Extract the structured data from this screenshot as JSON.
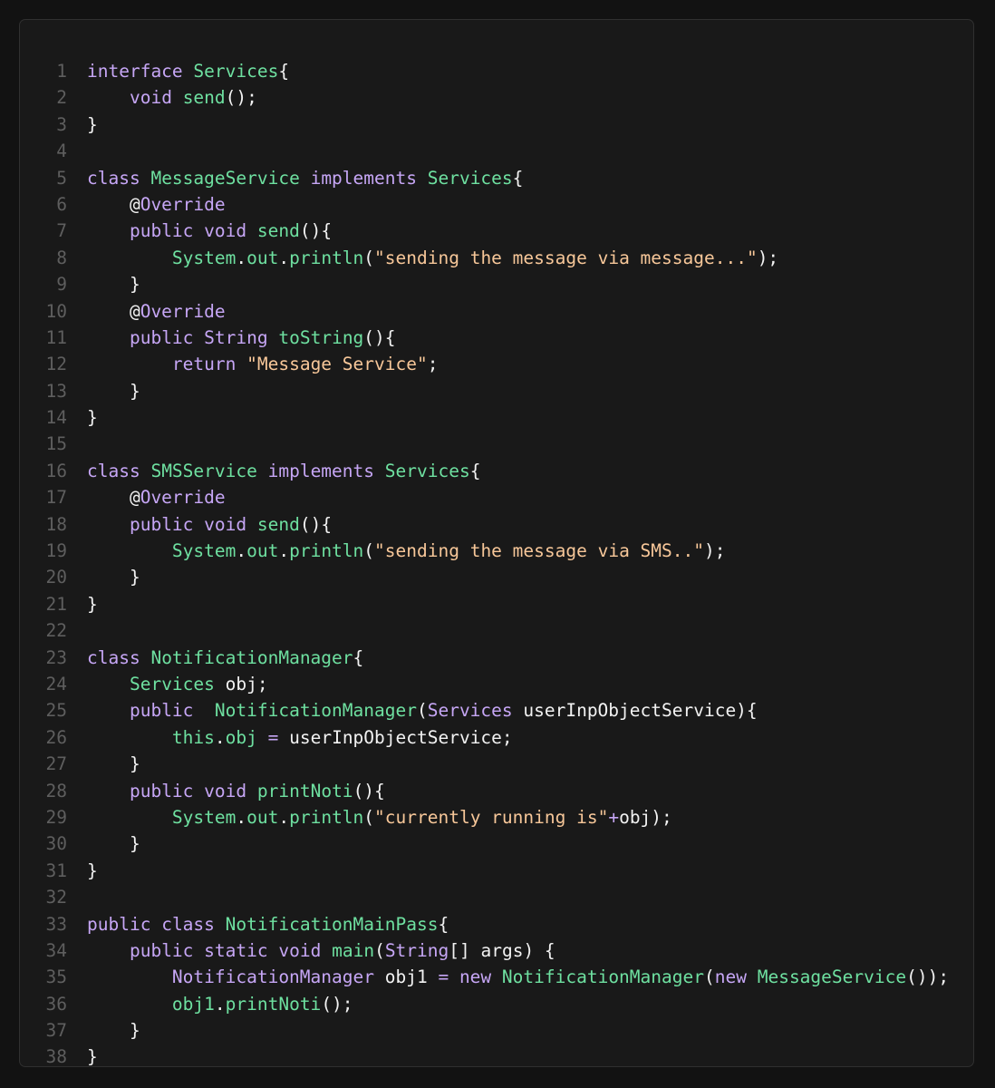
{
  "colors": {
    "background": "#121212",
    "panel": "#191919",
    "border": "#303030",
    "line_number": "#5e5e5e",
    "plain": "#f2f2f2",
    "keyword": "#c6a6f5",
    "type": "#6ee0a0",
    "string": "#f7c799"
  },
  "lines": [
    {
      "n": "1",
      "tokens": [
        [
          "kw",
          "interface"
        ],
        [
          "plain",
          " "
        ],
        [
          "type",
          "Services"
        ],
        [
          "plain",
          "{"
        ]
      ]
    },
    {
      "n": "2",
      "tokens": [
        [
          "plain",
          "    "
        ],
        [
          "kw",
          "void"
        ],
        [
          "plain",
          " "
        ],
        [
          "fn",
          "send"
        ],
        [
          "plain",
          "();"
        ]
      ]
    },
    {
      "n": "3",
      "tokens": [
        [
          "plain",
          "}"
        ]
      ]
    },
    {
      "n": "4",
      "tokens": []
    },
    {
      "n": "5",
      "tokens": [
        [
          "kw",
          "class"
        ],
        [
          "plain",
          " "
        ],
        [
          "type",
          "MessageService"
        ],
        [
          "plain",
          " "
        ],
        [
          "kw",
          "implements"
        ],
        [
          "plain",
          " "
        ],
        [
          "type",
          "Services"
        ],
        [
          "plain",
          "{"
        ]
      ]
    },
    {
      "n": "6",
      "tokens": [
        [
          "plain",
          "    @"
        ],
        [
          "ann",
          "Override"
        ]
      ]
    },
    {
      "n": "7",
      "tokens": [
        [
          "plain",
          "    "
        ],
        [
          "kw",
          "public"
        ],
        [
          "plain",
          " "
        ],
        [
          "kw",
          "void"
        ],
        [
          "plain",
          " "
        ],
        [
          "fn",
          "send"
        ],
        [
          "plain",
          "(){"
        ]
      ]
    },
    {
      "n": "8",
      "tokens": [
        [
          "plain",
          "        "
        ],
        [
          "type",
          "System"
        ],
        [
          "plain",
          "."
        ],
        [
          "fn",
          "out"
        ],
        [
          "plain",
          "."
        ],
        [
          "fn",
          "println"
        ],
        [
          "plain",
          "("
        ],
        [
          "str",
          "\"sending the message via message...\""
        ],
        [
          "plain",
          ");"
        ]
      ]
    },
    {
      "n": "9",
      "tokens": [
        [
          "plain",
          "    }"
        ]
      ]
    },
    {
      "n": "10",
      "tokens": [
        [
          "plain",
          "    @"
        ],
        [
          "ann",
          "Override"
        ]
      ]
    },
    {
      "n": "11",
      "tokens": [
        [
          "plain",
          "    "
        ],
        [
          "kw",
          "public"
        ],
        [
          "plain",
          " "
        ],
        [
          "kw",
          "String"
        ],
        [
          "plain",
          " "
        ],
        [
          "fn",
          "toString"
        ],
        [
          "plain",
          "(){"
        ]
      ]
    },
    {
      "n": "12",
      "tokens": [
        [
          "plain",
          "        "
        ],
        [
          "kw",
          "return"
        ],
        [
          "plain",
          " "
        ],
        [
          "str",
          "\"Message Service\""
        ],
        [
          "plain",
          ";"
        ]
      ]
    },
    {
      "n": "13",
      "tokens": [
        [
          "plain",
          "    }"
        ]
      ]
    },
    {
      "n": "14",
      "tokens": [
        [
          "plain",
          "}"
        ]
      ]
    },
    {
      "n": "15",
      "tokens": []
    },
    {
      "n": "16",
      "tokens": [
        [
          "kw",
          "class"
        ],
        [
          "plain",
          " "
        ],
        [
          "type",
          "SMSService"
        ],
        [
          "plain",
          " "
        ],
        [
          "kw",
          "implements"
        ],
        [
          "plain",
          " "
        ],
        [
          "type",
          "Services"
        ],
        [
          "plain",
          "{"
        ]
      ]
    },
    {
      "n": "17",
      "tokens": [
        [
          "plain",
          "    @"
        ],
        [
          "ann",
          "Override"
        ]
      ]
    },
    {
      "n": "18",
      "tokens": [
        [
          "plain",
          "    "
        ],
        [
          "kw",
          "public"
        ],
        [
          "plain",
          " "
        ],
        [
          "kw",
          "void"
        ],
        [
          "plain",
          " "
        ],
        [
          "fn",
          "send"
        ],
        [
          "plain",
          "(){"
        ]
      ]
    },
    {
      "n": "19",
      "tokens": [
        [
          "plain",
          "        "
        ],
        [
          "type",
          "System"
        ],
        [
          "plain",
          "."
        ],
        [
          "fn",
          "out"
        ],
        [
          "plain",
          "."
        ],
        [
          "fn",
          "println"
        ],
        [
          "plain",
          "("
        ],
        [
          "str",
          "\"sending the message via SMS..\""
        ],
        [
          "plain",
          ");"
        ]
      ]
    },
    {
      "n": "20",
      "tokens": [
        [
          "plain",
          "    }"
        ]
      ]
    },
    {
      "n": "21",
      "tokens": [
        [
          "plain",
          "}"
        ]
      ]
    },
    {
      "n": "22",
      "tokens": []
    },
    {
      "n": "23",
      "tokens": [
        [
          "kw",
          "class"
        ],
        [
          "plain",
          " "
        ],
        [
          "type",
          "NotificationManager"
        ],
        [
          "plain",
          "{"
        ]
      ]
    },
    {
      "n": "24",
      "tokens": [
        [
          "plain",
          "    "
        ],
        [
          "type",
          "Services"
        ],
        [
          "plain",
          " obj;"
        ]
      ]
    },
    {
      "n": "25",
      "tokens": [
        [
          "plain",
          "    "
        ],
        [
          "kw",
          "public"
        ],
        [
          "plain",
          "  "
        ],
        [
          "fn",
          "NotificationManager"
        ],
        [
          "plain",
          "("
        ],
        [
          "kw",
          "Services"
        ],
        [
          "plain",
          " userInpObjectService){"
        ]
      ]
    },
    {
      "n": "26",
      "tokens": [
        [
          "plain",
          "        "
        ],
        [
          "type",
          "this"
        ],
        [
          "plain",
          "."
        ],
        [
          "fn",
          "obj"
        ],
        [
          "plain",
          " "
        ],
        [
          "op",
          "="
        ],
        [
          "plain",
          " userInpObjectService;"
        ]
      ]
    },
    {
      "n": "27",
      "tokens": [
        [
          "plain",
          "    }"
        ]
      ]
    },
    {
      "n": "28",
      "tokens": [
        [
          "plain",
          "    "
        ],
        [
          "kw",
          "public"
        ],
        [
          "plain",
          " "
        ],
        [
          "kw",
          "void"
        ],
        [
          "plain",
          " "
        ],
        [
          "fn",
          "printNoti"
        ],
        [
          "plain",
          "(){"
        ]
      ]
    },
    {
      "n": "29",
      "tokens": [
        [
          "plain",
          "        "
        ],
        [
          "type",
          "System"
        ],
        [
          "plain",
          "."
        ],
        [
          "fn",
          "out"
        ],
        [
          "plain",
          "."
        ],
        [
          "fn",
          "println"
        ],
        [
          "plain",
          "("
        ],
        [
          "str",
          "\"currently running is\""
        ],
        [
          "op",
          "+"
        ],
        [
          "plain",
          "obj);"
        ]
      ]
    },
    {
      "n": "30",
      "tokens": [
        [
          "plain",
          "    }"
        ]
      ]
    },
    {
      "n": "31",
      "tokens": [
        [
          "plain",
          "}"
        ]
      ]
    },
    {
      "n": "32",
      "tokens": []
    },
    {
      "n": "33",
      "tokens": [
        [
          "kw",
          "public"
        ],
        [
          "plain",
          " "
        ],
        [
          "kw",
          "class"
        ],
        [
          "plain",
          " "
        ],
        [
          "type",
          "NotificationMainPass"
        ],
        [
          "plain",
          "{"
        ]
      ]
    },
    {
      "n": "34",
      "tokens": [
        [
          "plain",
          "    "
        ],
        [
          "kw",
          "public"
        ],
        [
          "plain",
          " "
        ],
        [
          "kw",
          "static"
        ],
        [
          "plain",
          " "
        ],
        [
          "kw",
          "void"
        ],
        [
          "plain",
          " "
        ],
        [
          "fn",
          "main"
        ],
        [
          "plain",
          "("
        ],
        [
          "kw",
          "String"
        ],
        [
          "plain",
          "[] args) {"
        ]
      ]
    },
    {
      "n": "35",
      "tokens": [
        [
          "plain",
          "        "
        ],
        [
          "kw",
          "NotificationManager"
        ],
        [
          "plain",
          " obj1 "
        ],
        [
          "op",
          "="
        ],
        [
          "plain",
          " "
        ],
        [
          "kw",
          "new"
        ],
        [
          "plain",
          " "
        ],
        [
          "fn",
          "NotificationManager"
        ],
        [
          "plain",
          "("
        ],
        [
          "kw",
          "new"
        ],
        [
          "plain",
          " "
        ],
        [
          "type",
          "MessageService"
        ],
        [
          "plain",
          "());"
        ]
      ]
    },
    {
      "n": "36",
      "tokens": [
        [
          "plain",
          "        "
        ],
        [
          "fn",
          "obj1"
        ],
        [
          "plain",
          "."
        ],
        [
          "fn",
          "printNoti"
        ],
        [
          "plain",
          "();"
        ]
      ]
    },
    {
      "n": "37",
      "tokens": [
        [
          "plain",
          "    }"
        ]
      ]
    },
    {
      "n": "38",
      "tokens": [
        [
          "plain",
          "}"
        ]
      ]
    }
  ]
}
